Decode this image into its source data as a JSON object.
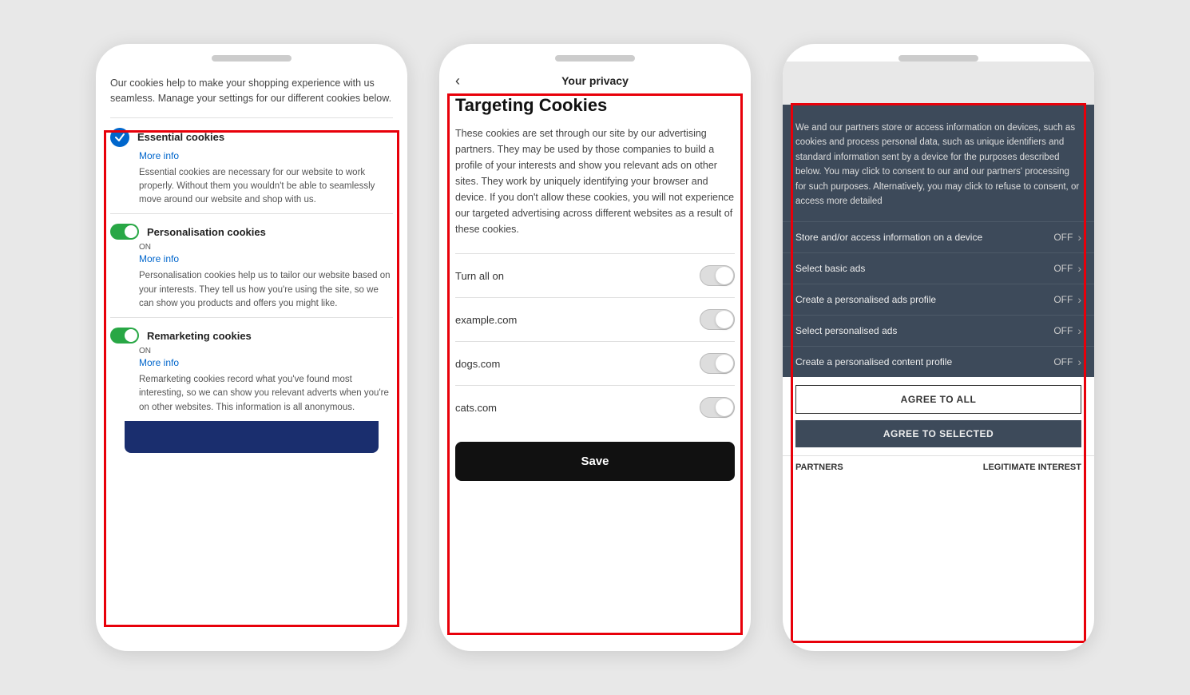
{
  "phone1": {
    "intro": "Our cookies help to make your shopping experience with us seamless. Manage your settings for our different cookies below.",
    "sections": [
      {
        "title": "Essential cookies",
        "more_info": "More info",
        "desc": "Essential cookies are necessary for our website to work properly. Without them you wouldn't be able to seamlessly move around our website and shop with us.",
        "type": "check",
        "label": null
      },
      {
        "title": "Personalisation cookies",
        "more_info": "More info",
        "desc": "Personalisation cookies help us to tailor our website based on your interests. They tell us how you're using the site, so we can show you products and offers you might like.",
        "type": "toggle_on",
        "label": "ON"
      },
      {
        "title": "Remarketing cookies",
        "more_info": "More info",
        "desc": "Remarketing cookies record what you've found most interesting, so we can show you relevant adverts when you're on other websites. This information is all anonymous.",
        "type": "toggle_on",
        "label": "ON"
      }
    ]
  },
  "phone2": {
    "back_label": "‹",
    "title": "Your privacy",
    "cookie_title": "Targeting Cookies",
    "desc": "These cookies are set through our site by our advertising partners. They may be used by those companies to build a profile of your interests and show you relevant ads on other sites. They work by uniquely identifying your browser and device. If you don't allow these cookies, you will not experience our targeted advertising across different websites as a result of these cookies.",
    "toggle_rows": [
      {
        "label": "Turn all on"
      },
      {
        "label": "example.com"
      },
      {
        "label": "dogs.com"
      },
      {
        "label": "cats.com"
      }
    ],
    "save_label": "Save"
  },
  "phone3": {
    "intro": "We and our partners store or access information on devices, such as cookies and process personal data, such as unique identifiers and standard information sent by a device for the purposes described below. You may click to consent to our and our partners' processing for such purposes. Alternatively, you may click to refuse to consent, or access more detailed",
    "rows": [
      {
        "label": "Store and/or access information on a device",
        "value": "OFF"
      },
      {
        "label": "Select basic ads",
        "value": "OFF"
      },
      {
        "label": "Create a personalised ads profile",
        "value": "OFF"
      },
      {
        "label": "Select personalised ads",
        "value": "OFF"
      },
      {
        "label": "Create a personalised content profile",
        "value": "OFF"
      }
    ],
    "agree_all": "AGREE TO ALL",
    "agree_selected": "AGREE TO SELECTED",
    "footer_left": "PARTNERS",
    "footer_right": "LEGITIMATE INTEREST"
  }
}
